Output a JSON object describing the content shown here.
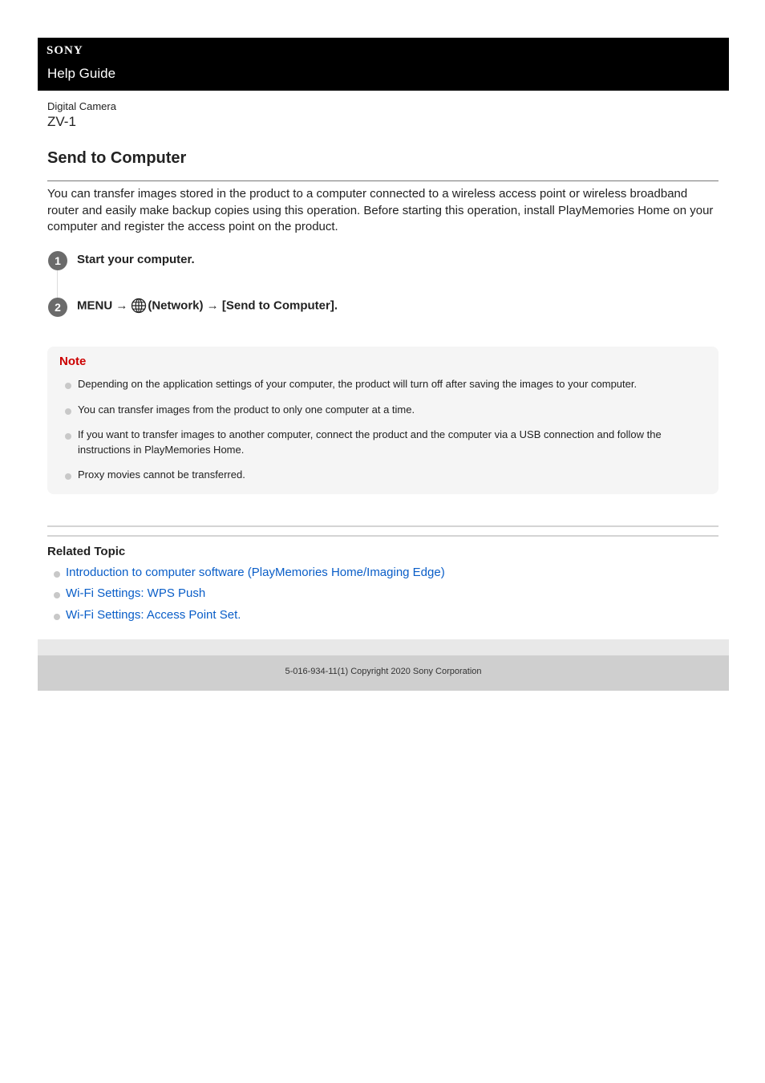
{
  "header": {
    "brand": "SONY",
    "guide_title": "Help Guide"
  },
  "product": {
    "category": "Digital Camera",
    "model": "ZV-1"
  },
  "page": {
    "title": "Send to Computer",
    "intro": "You can transfer images stored in the product to a computer connected to a wireless access point or wireless broadband router and easily make backup copies using this operation. Before starting this operation, install PlayMemories Home on your computer and register the access point on the product."
  },
  "steps": [
    {
      "number": "1",
      "text": "Start your computer."
    },
    {
      "number": "2",
      "text_before": "MENU →",
      "icon": "network-globe-icon",
      "text_after": "(Network) → [Send to Computer]."
    }
  ],
  "note": {
    "title": "Note",
    "items": [
      "Depending on the application settings of your computer, the product will turn off after saving the images to your computer.",
      "You can transfer images from the product to only one computer at a time.",
      "If you want to transfer images to another computer, connect the product and the computer via a USB connection and follow the instructions in PlayMemories Home.",
      "Proxy movies cannot be transferred."
    ]
  },
  "related": {
    "title": "Related Topic",
    "links": [
      "Introduction to computer software (PlayMemories Home/Imaging Edge)",
      "Wi-Fi Settings: WPS Push",
      "Wi-Fi Settings: Access Point Set."
    ]
  },
  "footer": {
    "copyright": "5-016-934-11(1) Copyright 2020 Sony Corporation"
  },
  "colors": {
    "header_bg": "#000000",
    "note_title": "#cc0000",
    "link": "#0a5ec8",
    "note_bg": "#f5f5f5",
    "footer_bg": "#cfcfcf"
  }
}
